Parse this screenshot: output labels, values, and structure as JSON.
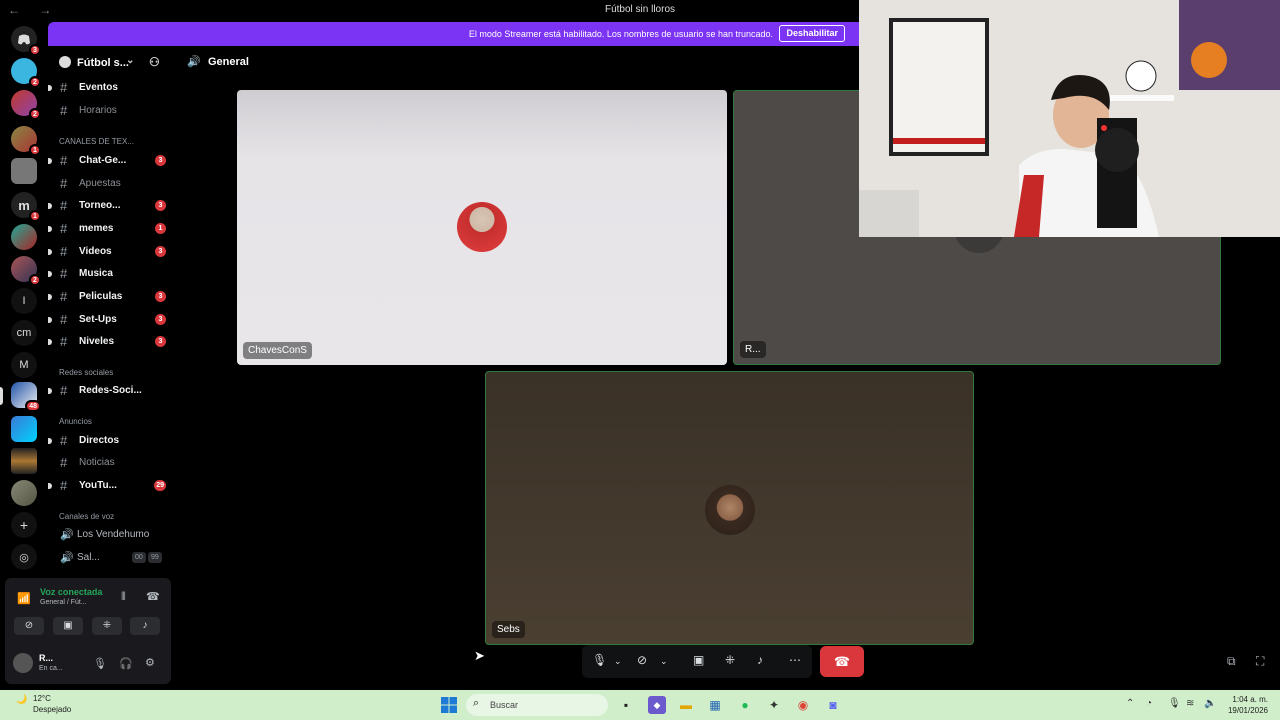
{
  "titlebar": {
    "nav": "←  →",
    "title": "Fútbol sin lloros"
  },
  "banner": {
    "message": "El modo Streamer está habilitado. Los nombres de usuario se han truncado.",
    "button": "Deshabilitar"
  },
  "rail": {
    "badges": [
      "3",
      "2",
      "2",
      "1",
      "1",
      "2",
      "48"
    ],
    "letters": [
      "I",
      "cm",
      "M"
    ]
  },
  "server": {
    "name": "Fútbol s..."
  },
  "channels": [
    {
      "label": "Eventos",
      "count": ""
    },
    {
      "label": "Horarios",
      "count": ""
    },
    {
      "label": "Chat-Ge...",
      "count": "3"
    },
    {
      "label": "Apuestas",
      "count": ""
    },
    {
      "label": "Torneo...",
      "count": "3"
    },
    {
      "label": "memes",
      "count": "1"
    },
    {
      "label": "Videos",
      "count": "3"
    },
    {
      "label": "Musica",
      "count": ""
    },
    {
      "label": "Peliculas",
      "count": "3"
    },
    {
      "label": "Set-Ups",
      "count": "3"
    },
    {
      "label": "Niveles",
      "count": "3"
    },
    {
      "label": "Redes-Soci...",
      "count": ""
    },
    {
      "label": "Directos",
      "count": ""
    },
    {
      "label": "Noticias",
      "count": ""
    },
    {
      "label": "YouTu...",
      "count": "29"
    }
  ],
  "categories": {
    "text": "CANALES DE TEX...",
    "social": "Redes sociales",
    "announce": "Anuncios",
    "voice": "Canales de voz"
  },
  "voice_channels": [
    {
      "label": "Los Vendehumo"
    },
    {
      "label": "Sal...",
      "tags": [
        "00",
        "99"
      ]
    }
  ],
  "voice_panel": {
    "status": "Voz conectada",
    "channel": "General / Fút...",
    "user": "R...",
    "user_status": "En ca..."
  },
  "main": {
    "channel": "General"
  },
  "participants": [
    {
      "name": "ChavesConS"
    },
    {
      "name": "R..."
    },
    {
      "name": "Sebs"
    }
  ],
  "taskbar": {
    "temp": "12°C",
    "weather": "Despejado",
    "search_placeholder": "Buscar",
    "time": "1:04 a. m.",
    "date": "19/01/2026"
  }
}
